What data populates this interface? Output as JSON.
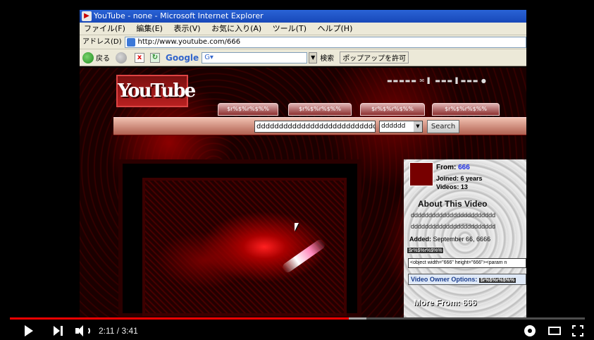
{
  "ie": {
    "title": "YouTube - none - Microsoft Internet Explorer",
    "menu": [
      "ファイル(F)",
      "編集(E)",
      "表示(V)",
      "お気に入り(A)",
      "ツール(T)",
      "ヘルプ(H)"
    ],
    "address_label": "アドレス(D)",
    "address_value": "http://www.youtube.com/666",
    "back_label": "戻る",
    "google_label": "Google",
    "google_box": "G▾",
    "search_label": "検索",
    "popup_label": "ポップアップを許可"
  },
  "yt": {
    "logo": "YouTube",
    "nav_tabs": [
      "$r%$%r%$%%",
      "$r%$%r%$%%",
      "$r%$%r%$%%",
      "$r%$%r%$%%"
    ],
    "search_value": "dddddddddddddddddddddddddddddd",
    "search_select": "dddddd",
    "search_button": "Search",
    "from_label": "From:",
    "from_user": "666",
    "joined": "Joined: 6 years",
    "videos": "Videos: 13",
    "about_title": "About This Video",
    "desc_line1": "dddddddddddddddddddddddd",
    "desc_line2": "dddddddddddddddddddddddd",
    "added_label": "Added:",
    "added_value": "September 66, 6666",
    "garble1": "$r%$%r%$%%",
    "embed_value": "<object width=\"666\" height=\"666\"><param n",
    "owner_label": "Video Owner Options:",
    "owner_garble": "$r%$%r%$%%",
    "more_from": "More From: 666"
  },
  "player": {
    "time": "2:11 / 3:41",
    "progress_fraction": 0.59,
    "buffer_fraction": 0.62
  }
}
